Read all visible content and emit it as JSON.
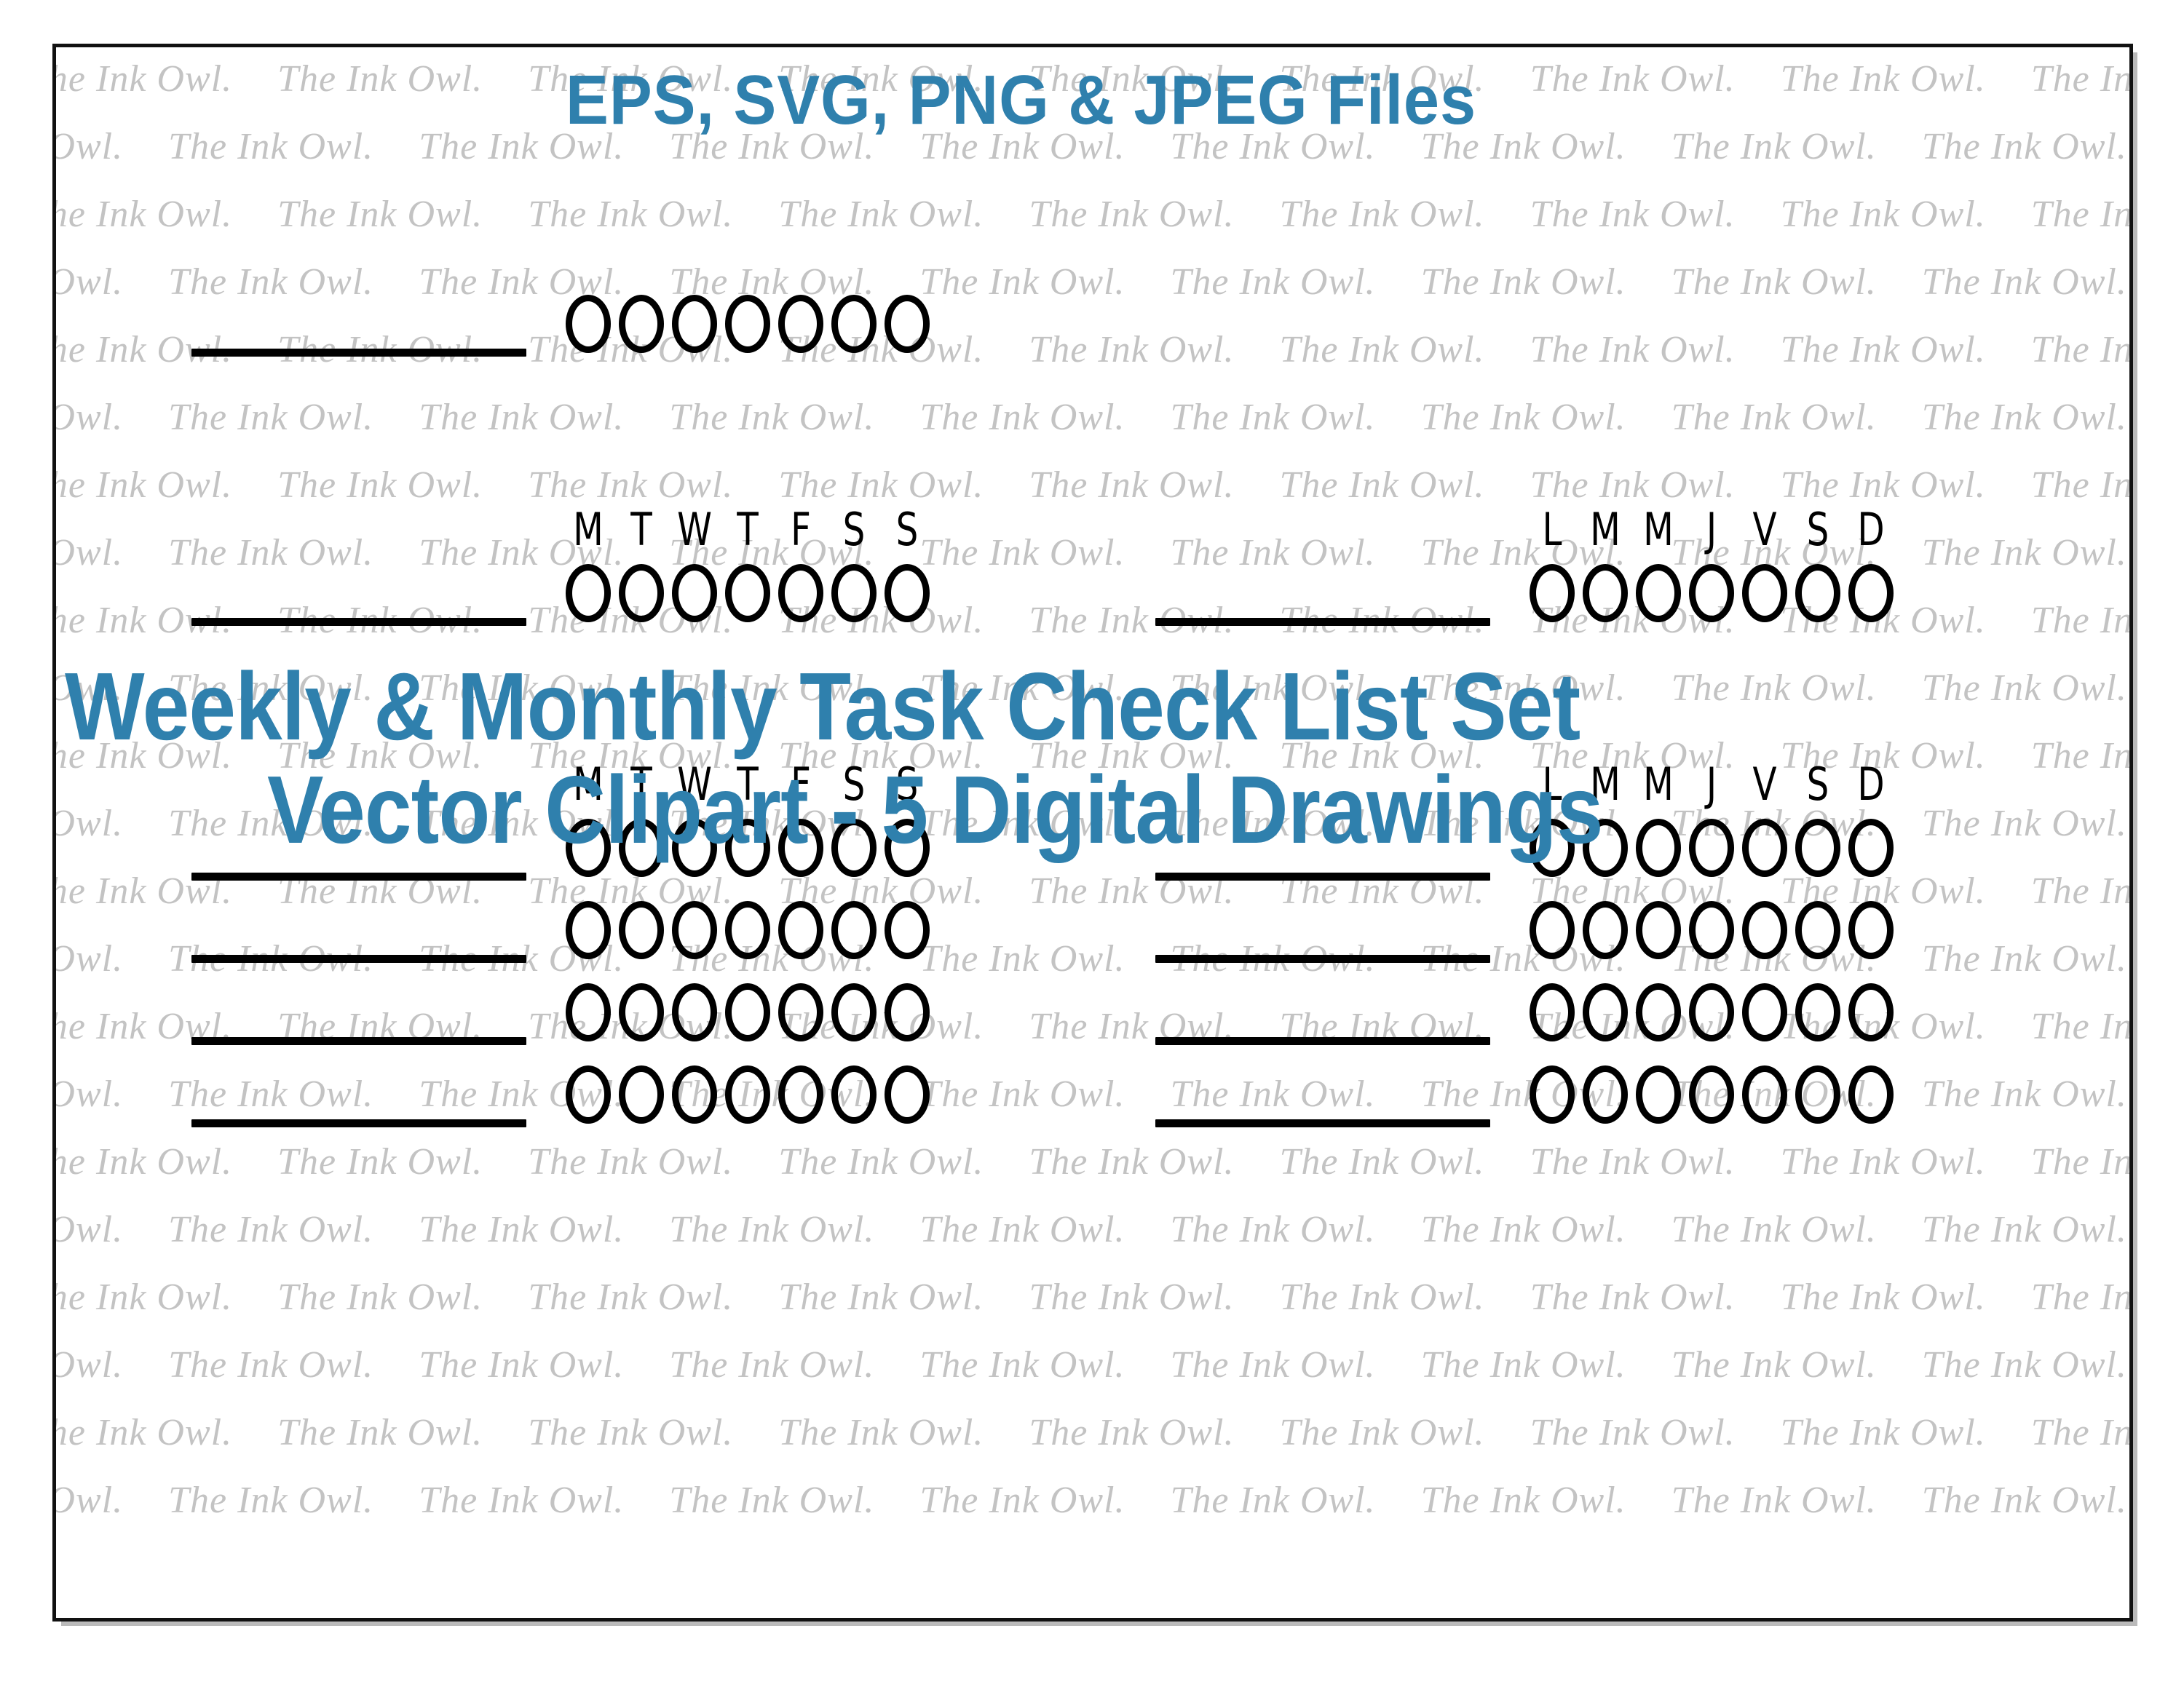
{
  "document": {
    "background_color": "#ffffff",
    "frame_border_color": "#111111",
    "accent_color": "#2f80ad",
    "ink_color": "#000000",
    "watermark_color": "#c3c3c3"
  },
  "watermark": {
    "text": "The Ink Owl.",
    "repeat_per_row": 9,
    "rows": 22
  },
  "headline": {
    "files_label": "EPS, SVG, PNG & JPEG Files"
  },
  "title": {
    "line1": "Weekly & Monthly Task Check List Set",
    "line2": "Vector Clipart - 5 Digital Drawings"
  },
  "day_labels": {
    "english": [
      "M",
      "T",
      "W",
      "T",
      "F",
      "S",
      "S"
    ],
    "french": [
      "L",
      "M",
      "M",
      "J",
      "V",
      "S",
      "D"
    ]
  },
  "checklists": [
    {
      "id": "single-plain-weekly",
      "name": "single-row-plain",
      "has_day_header": false,
      "rows": 1,
      "bubbles_per_row": 7,
      "line_label": ""
    },
    {
      "id": "single-weekly-english",
      "name": "single-row-weekly-english",
      "has_day_header": true,
      "day_header": [
        "M",
        "T",
        "W",
        "T",
        "F",
        "S",
        "S"
      ],
      "rows": 1,
      "bubbles_per_row": 7,
      "line_label": ""
    },
    {
      "id": "single-weekly-french",
      "name": "single-row-weekly-french",
      "has_day_header": true,
      "day_header": [
        "L",
        "M",
        "M",
        "J",
        "V",
        "S",
        "D"
      ],
      "rows": 1,
      "bubbles_per_row": 7,
      "line_label": ""
    },
    {
      "id": "multi-weekly-english",
      "name": "four-row-weekly-english",
      "has_day_header": true,
      "day_header": [
        "M",
        "T",
        "W",
        "T",
        "F",
        "S",
        "S"
      ],
      "rows": 4,
      "bubbles_per_row": 7,
      "line_label": ""
    },
    {
      "id": "multi-weekly-french",
      "name": "four-row-weekly-french",
      "has_day_header": true,
      "day_header": [
        "L",
        "M",
        "M",
        "J",
        "V",
        "S",
        "D"
      ],
      "rows": 4,
      "bubbles_per_row": 7,
      "line_label": ""
    }
  ]
}
